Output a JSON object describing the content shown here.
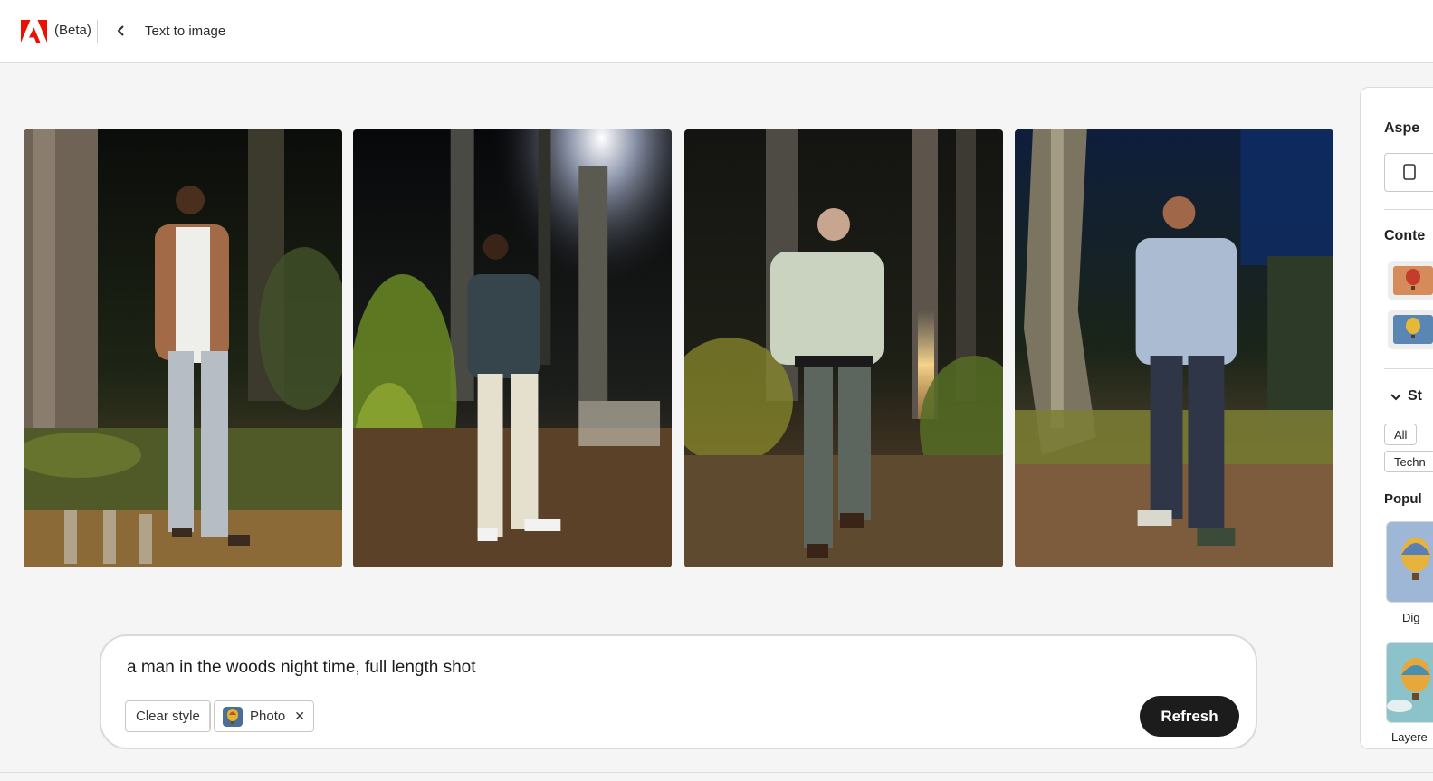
{
  "header": {
    "beta_label": "(Beta)",
    "page_title": "Text to image"
  },
  "images": [
    {
      "alt": "generated image 1"
    },
    {
      "alt": "generated image 2"
    },
    {
      "alt": "generated image 3"
    },
    {
      "alt": "generated image 4"
    }
  ],
  "prompt": {
    "text": "a man in the woods night time, full length shot",
    "clear_style_label": "Clear style",
    "style_chip_label": "Photo",
    "refresh_label": "Refresh"
  },
  "right_panel": {
    "aspect_heading": "Aspe",
    "content_heading": "Conte",
    "styles_heading": "St",
    "filter_all": "All",
    "filter_tech": "Techn",
    "popular_heading": "Popul",
    "style_1_caption": "Dig",
    "style_2_caption": "Layere"
  },
  "colors": {
    "accent": "#eb1000",
    "cta_bg": "#1c1c1c"
  }
}
